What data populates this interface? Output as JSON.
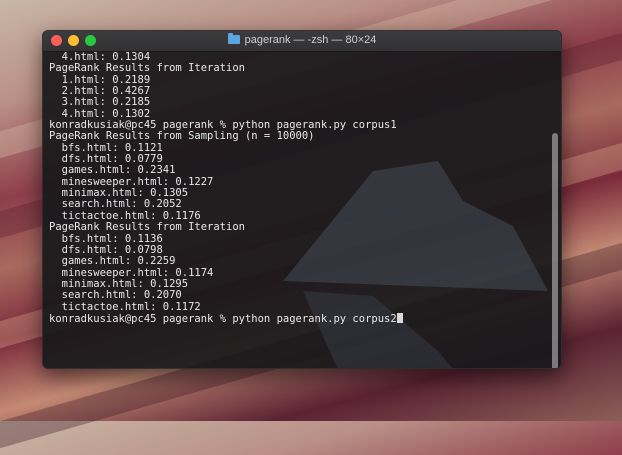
{
  "window": {
    "title": "pagerank — -zsh — 80×24",
    "folder_icon": "folder-icon"
  },
  "terminal": {
    "lines": [
      "  4.html: 0.1304",
      "PageRank Results from Iteration",
      "  1.html: 0.2189",
      "  2.html: 0.4267",
      "  3.html: 0.2185",
      "  4.html: 0.1302",
      "konradkusiak@pc45 pagerank % python pagerank.py corpus1",
      "PageRank Results from Sampling (n = 10000)",
      "  bfs.html: 0.1121",
      "  dfs.html: 0.0779",
      "  games.html: 0.2341",
      "  minesweeper.html: 0.1227",
      "  minimax.html: 0.1305",
      "  search.html: 0.2052",
      "  tictactoe.html: 0.1176",
      "PageRank Results from Iteration",
      "  bfs.html: 0.1136",
      "  dfs.html: 0.0798",
      "  games.html: 0.2259",
      "  minesweeper.html: 0.1174",
      "  minimax.html: 0.1295",
      "  search.html: 0.2070",
      "  tictactoe.html: 0.1172"
    ],
    "prompt_line": "konradkusiak@pc45 pagerank % python pagerank.py corpus2"
  },
  "colors": {
    "close": "#fe5f57",
    "minimize": "#febc2e",
    "maximize": "#28c840",
    "terminal_text": "#e8e8e8"
  }
}
